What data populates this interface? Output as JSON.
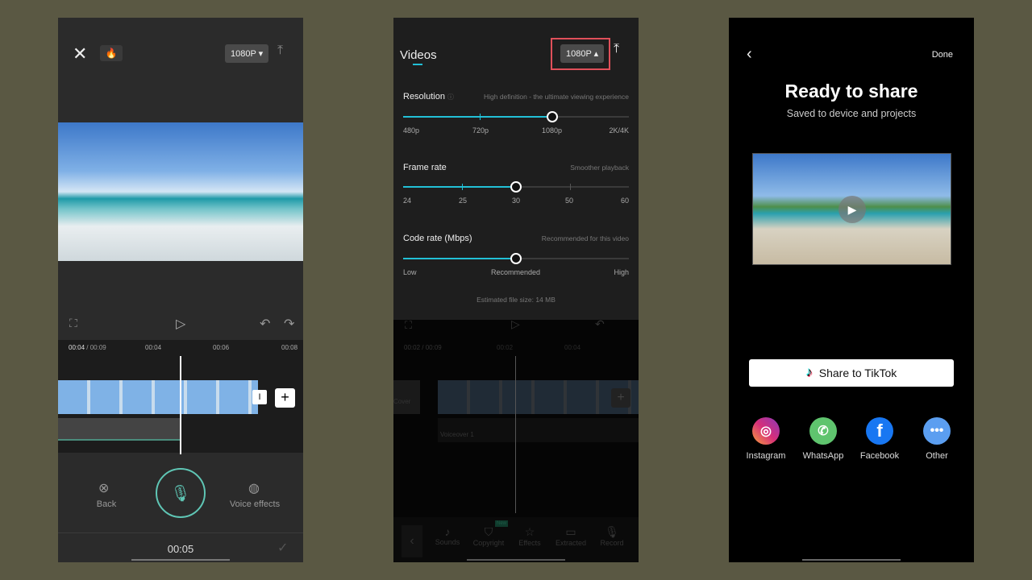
{
  "colors": {
    "background": "#5a5843",
    "accent": "#22c0d6",
    "record_ring": "#5fc6b5",
    "highlight_box": "#e0505a"
  },
  "screen1": {
    "resolution_button": "1080P",
    "timecode_current": "00:04",
    "timecode_total": "/ 00:09",
    "ruler": [
      "00:04",
      "00:06",
      "00:08"
    ],
    "back_label": "Back",
    "voice_effects_label": "Voice effects",
    "record_time": "00:05",
    "icons": [
      "close-icon",
      "fire-icon",
      "export-icon",
      "fullscreen-icon",
      "play-icon",
      "undo-icon",
      "redo-icon",
      "add-icon",
      "mic-icon",
      "check-icon"
    ]
  },
  "screen2": {
    "tab": "Videos",
    "resolution_button": "1080P",
    "resolution": {
      "title": "Resolution",
      "hint": "High definition - the ultimate viewing experience",
      "options": [
        "480p",
        "720p",
        "1080p",
        "2K/4K"
      ],
      "selected": "1080p"
    },
    "frame_rate": {
      "title": "Frame rate",
      "hint": "Smoother playback",
      "options": [
        "24",
        "25",
        "30",
        "50",
        "60"
      ],
      "selected": "30"
    },
    "code_rate": {
      "title": "Code rate (Mbps)",
      "hint": "Recommended for this video",
      "options": [
        "Low",
        "Recommended",
        "High"
      ],
      "selected": "Recommended"
    },
    "file_size": "Estimated file size: 14 MB",
    "timecode_current": "00:02",
    "timecode_total": "/ 00:09",
    "ruler": [
      "00:02",
      "00:04"
    ],
    "cover_label": "Cover",
    "voiceover_label": "Voiceover 1",
    "toolbar": [
      {
        "label": "Sounds"
      },
      {
        "label": "Copyright",
        "badge": "New"
      },
      {
        "label": "Effects"
      },
      {
        "label": "Extracted"
      },
      {
        "label": "Record"
      }
    ]
  },
  "screen3": {
    "done": "Done",
    "title": "Ready to share",
    "subtitle": "Saved to device and projects",
    "tiktok_button": "Share to TikTok",
    "share": [
      {
        "label": "Instagram",
        "color": "#c13584"
      },
      {
        "label": "WhatsApp",
        "color": "#5fc46e"
      },
      {
        "label": "Facebook",
        "color": "#1877f2"
      },
      {
        "label": "Other",
        "color": "#5b9ef0"
      }
    ]
  }
}
